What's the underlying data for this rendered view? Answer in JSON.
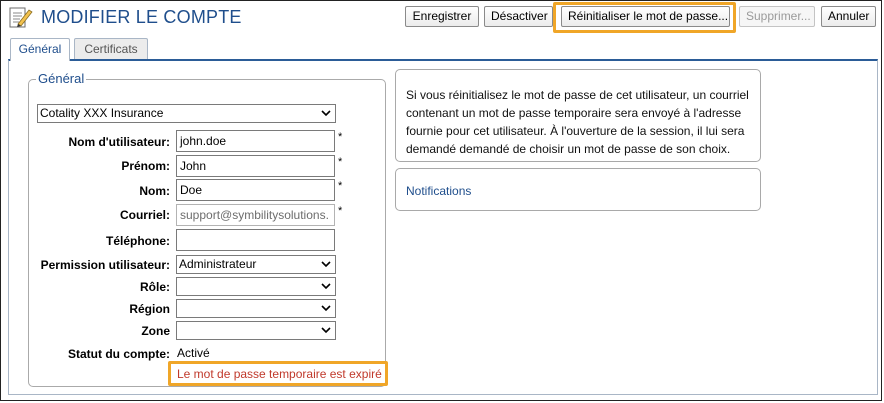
{
  "header": {
    "title": "MODIFIER LE COMPTE",
    "buttons": {
      "save": "Enregistrer",
      "deactivate": "Désactiver",
      "reset_password": "Réinitialiser le mot de passe...",
      "delete": "Supprimer...",
      "cancel": "Annuler"
    }
  },
  "tabs": [
    {
      "label": "Général",
      "active": true
    },
    {
      "label": "Certificats",
      "active": false
    }
  ],
  "general": {
    "legend": "Général",
    "company": "Cotality XXX Insurance",
    "fields": {
      "username": {
        "label": "Nom d'utilisateur:",
        "value": "john.doe",
        "required": "*"
      },
      "first_name": {
        "label": "Prénom:",
        "value": "John",
        "required": "*"
      },
      "last_name": {
        "label": "Nom:",
        "value": "Doe",
        "required": "*"
      },
      "email": {
        "label": "Courriel:",
        "value": "support@symbilitysolutions.",
        "required": "*"
      },
      "phone": {
        "label": "Téléphone:",
        "value": ""
      },
      "permission": {
        "label": "Permission utilisateur:",
        "value": "Administrateur"
      },
      "role": {
        "label": "Rôle:",
        "value": ""
      },
      "region": {
        "label": "Région",
        "value": ""
      },
      "zone": {
        "label": "Zone",
        "value": ""
      }
    },
    "account_status": {
      "label": "Statut du compte:",
      "value": "Activé"
    },
    "expired_message": "Le mot de passe temporaire est expiré"
  },
  "info_panel": {
    "text": "Si vous réinitialisez le mot de passe de cet utilisateur, un courriel contenant un mot de passe temporaire sera envoyé à l'adresse fournie pour cet utilisateur. À l'ouverture de la session, il lui sera demandé demandé de choisir un mot de passe de son choix."
  },
  "notifications_panel": {
    "link": "Notifications"
  },
  "icons": {
    "title": "edit-form-icon",
    "dropdown": "chevron-down-icon"
  },
  "colors": {
    "title": "#1f4e8c",
    "highlight": "#f0a628",
    "expired": "#c0392b"
  }
}
